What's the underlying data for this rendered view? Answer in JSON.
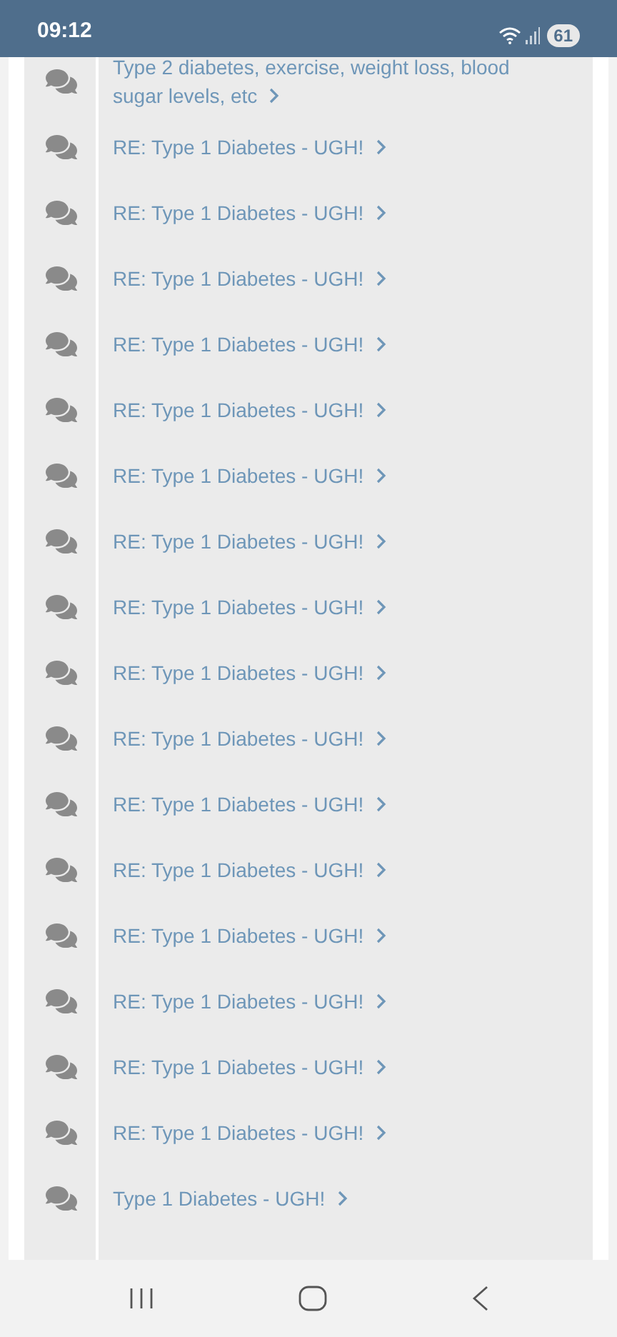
{
  "status_bar": {
    "time": "09:12",
    "battery": "61"
  },
  "threads": [
    {
      "title": "Type 2 diabetes, exercise, weight loss, blood sugar levels, etc"
    },
    {
      "title": "RE: Type 1 Diabetes - UGH!"
    },
    {
      "title": "RE: Type 1 Diabetes - UGH!"
    },
    {
      "title": "RE: Type 1 Diabetes - UGH!"
    },
    {
      "title": "RE: Type 1 Diabetes - UGH!"
    },
    {
      "title": "RE: Type 1 Diabetes - UGH!"
    },
    {
      "title": "RE: Type 1 Diabetes - UGH!"
    },
    {
      "title": "RE: Type 1 Diabetes - UGH!"
    },
    {
      "title": "RE: Type 1 Diabetes - UGH!"
    },
    {
      "title": "RE: Type 1 Diabetes - UGH!"
    },
    {
      "title": "RE: Type 1 Diabetes - UGH!"
    },
    {
      "title": "RE: Type 1 Diabetes - UGH!"
    },
    {
      "title": "RE: Type 1 Diabetes - UGH!"
    },
    {
      "title": "RE: Type 1 Diabetes - UGH!"
    },
    {
      "title": "RE: Type 1 Diabetes - UGH!"
    },
    {
      "title": "RE: Type 1 Diabetes - UGH!"
    },
    {
      "title": "RE: Type 1 Diabetes - UGH!"
    },
    {
      "title": "Type 1 Diabetes - UGH!"
    }
  ]
}
